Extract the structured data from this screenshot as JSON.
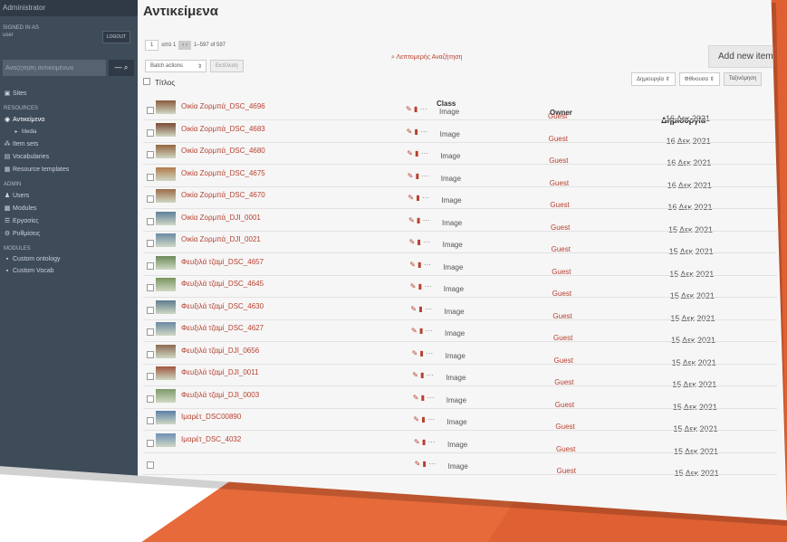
{
  "sidebar": {
    "admin_title": "Administrator",
    "signed_in_label": "SIGNED IN AS",
    "user": "user",
    "logout_label": "LOGOUT",
    "search_placeholder": "Αναζήτηση αντικειμένων",
    "search_dropdown": "—",
    "nav": [
      {
        "label": "Sites",
        "icon": "sitemap-icon",
        "type": "item"
      },
      {
        "label": "RESOURCES",
        "type": "section"
      },
      {
        "label": "Αντικείμενα",
        "icon": "items-icon",
        "type": "item",
        "active": true
      },
      {
        "label": "Media",
        "icon": "chevron-right-icon",
        "type": "sub"
      },
      {
        "label": "Item sets",
        "icon": "item-sets-icon",
        "type": "item"
      },
      {
        "label": "Vocabularies",
        "icon": "vocabularies-icon",
        "type": "item"
      },
      {
        "label": "Resource templates",
        "icon": "templates-icon",
        "type": "item"
      },
      {
        "label": "ADMIN",
        "type": "section"
      },
      {
        "label": "Users",
        "icon": "users-icon",
        "type": "item"
      },
      {
        "label": "Modules",
        "icon": "modules-icon",
        "type": "item"
      },
      {
        "label": "Εργασίες",
        "icon": "jobs-icon",
        "type": "item"
      },
      {
        "label": "Ρυθμίσεις",
        "icon": "settings-icon",
        "type": "item"
      },
      {
        "label": "MODULES",
        "type": "section"
      },
      {
        "label": "Custom ontology",
        "icon": "module-icon",
        "type": "item"
      },
      {
        "label": "Custom Vocab",
        "icon": "module-icon",
        "type": "item"
      }
    ]
  },
  "main": {
    "page_title": "Αντικείμενα",
    "add_new_label": "Add new item",
    "pager": {
      "page": "1",
      "of": "από 1",
      "range": "1–597 of 597"
    },
    "advanced_search": "Λεπτομερής Αναζήτηση",
    "batch": {
      "select": "Batch actions",
      "go": "Εκτέλεση"
    },
    "sort": {
      "field": "Δημιουργία",
      "order": "Φθίνουσα",
      "button": "Ταξινόμηση"
    },
    "columns": {
      "title": "Τίτλος",
      "class": "Class",
      "owner": "Owner",
      "created": "Δημιουργία"
    },
    "rows": [
      {
        "title": "Οικία Ζορμπά_DSC_4696",
        "class": "Image",
        "owner": "Guest",
        "date": "16 Δεκ 2021",
        "thumb": "#8a5a3c"
      },
      {
        "title": "Οικία Ζορμπά_DSC_4683",
        "class": "Image",
        "owner": "Guest",
        "date": "16 Δεκ 2021",
        "thumb": "#7a4a34"
      },
      {
        "title": "Οικία Ζορμπά_DSC_4680",
        "class": "Image",
        "owner": "Guest",
        "date": "16 Δεκ 2021",
        "thumb": "#93643f"
      },
      {
        "title": "Οικία Ζορμπά_DSC_4675",
        "class": "Image",
        "owner": "Guest",
        "date": "16 Δεκ 2021",
        "thumb": "#b07a4c"
      },
      {
        "title": "Οικία Ζορμπά_DSC_4670",
        "class": "Image",
        "owner": "Guest",
        "date": "16 Δεκ 2021",
        "thumb": "#9b6b48"
      },
      {
        "title": "Οικία Ζορμπά_DJI_0001",
        "class": "Image",
        "owner": "Guest",
        "date": "15 Δεκ 2021",
        "thumb": "#5f7f9a"
      },
      {
        "title": "Οικία Ζορμπά_DJI_0021",
        "class": "Image",
        "owner": "Guest",
        "date": "15 Δεκ 2021",
        "thumb": "#6b8aa4"
      },
      {
        "title": "Φευξιλά τζαμί_DSC_4657",
        "class": "Image",
        "owner": "Guest",
        "date": "15 Δεκ 2021",
        "thumb": "#6d8a58"
      },
      {
        "title": "Φευξιλά τζαμί_DSC_4645",
        "class": "Image",
        "owner": "Guest",
        "date": "15 Δεκ 2021",
        "thumb": "#7a945f"
      },
      {
        "title": "Φευξιλά τζαμί_DSC_4630",
        "class": "Image",
        "owner": "Guest",
        "date": "15 Δεκ 2021",
        "thumb": "#5e7d8e"
      },
      {
        "title": "Φευξιλά τζαμί_DSC_4627",
        "class": "Image",
        "owner": "Guest",
        "date": "15 Δεκ 2021",
        "thumb": "#6a88a0"
      },
      {
        "title": "Φευξιλά τζαμί_DJI_0656",
        "class": "Image",
        "owner": "Guest",
        "date": "15 Δεκ 2021",
        "thumb": "#8c6a52"
      },
      {
        "title": "Φευξιλά τζαμί_DJI_0011",
        "class": "Image",
        "owner": "Guest",
        "date": "15 Δεκ 2021",
        "thumb": "#a0563e"
      },
      {
        "title": "Φευξιλά τζαμί_DJI_0003",
        "class": "Image",
        "owner": "Guest",
        "date": "15 Δεκ 2021",
        "thumb": "#7d9a6a"
      },
      {
        "title": "Ιμαρέτ_DSC00890",
        "class": "Image",
        "owner": "Guest",
        "date": "15 Δεκ 2021",
        "thumb": "#5b7fa8"
      },
      {
        "title": "Ιμαρέτ_DSC_4032",
        "class": "Image",
        "owner": "Guest",
        "date": "15 Δεκ 2021",
        "thumb": "#6f8fb5"
      },
      {
        "title": "",
        "class": "Image",
        "owner": "Guest",
        "date": "15 Δεκ 2021",
        "thumb": ""
      }
    ]
  },
  "colors": {
    "accent": "#b7402f",
    "sidebar": "#3e4b59",
    "background_shape": "#e66a3a"
  }
}
